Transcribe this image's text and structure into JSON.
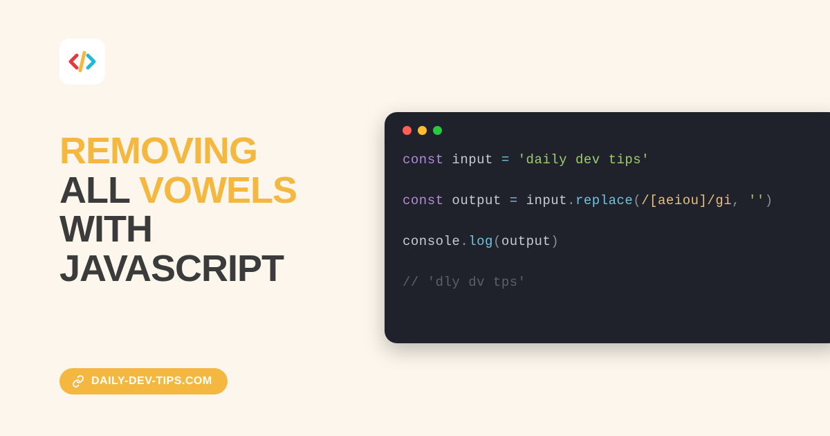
{
  "title_words": [
    {
      "text": "REMOVING",
      "color": "yellow"
    },
    {
      "text": "ALL",
      "color": "dark"
    },
    {
      "text": "VOWELS",
      "color": "yellow"
    },
    {
      "text": "WITH",
      "color": "dark"
    },
    {
      "text": "JAVASCRIPT",
      "color": "dark"
    }
  ],
  "url": "DAILY-DEV-TIPS.COM",
  "code": {
    "line1": {
      "keyword": "const",
      "ident": "input",
      "eq": "=",
      "string": "'daily dev tips'"
    },
    "line2": {
      "keyword": "const",
      "ident": "output",
      "eq": "=",
      "obj": "input",
      "dot": ".",
      "method": "replace",
      "lparen": "(",
      "regex": "/[aeiou]/gi",
      "comma": ",",
      "arg2": "''",
      "rparen": ")"
    },
    "line3": {
      "obj": "console",
      "dot": ".",
      "method": "log",
      "lparen": "(",
      "arg": "output",
      "rparen": ")"
    },
    "line4": {
      "comment": "// 'dly dv tps'"
    }
  }
}
